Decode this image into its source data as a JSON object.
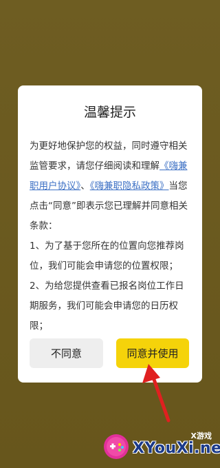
{
  "dialog": {
    "title": "温馨提示",
    "intro_text": "为更好地保护您的权益，同时遵守相关监管要求，请您仔细阅读和理解",
    "link_user_agreement": "《嗨兼职用户协议》",
    "separator": "、",
    "link_privacy_policy": "《嗨兼职隐私政策》",
    "consent_text": "当您点击“同意”即表示您已理解并同意相关条款：",
    "clause_1": "1、为了基于您所在的位置向您推荐岗位，我们可能会申请您的位置权限；",
    "clause_2": "2、为给您提供查看已报名岗位工作日期服务，我们可能会申请您的日历权限；",
    "disagree_label": "不同意",
    "agree_label": "同意并使用"
  },
  "annotation": {
    "arrow_icon": "red-arrow-pointing-up",
    "color": "#e02020"
  },
  "watermark": {
    "site": "XYouXi.net",
    "brand_cn": "X游戏",
    "logo_icon": "gamepad-icon"
  },
  "colors": {
    "backdrop": "#6b5a1f",
    "dialog_bg": "#ffffff",
    "link": "#3b6fc4",
    "agree_button": "#f5d30a",
    "disagree_button": "#eeeeee"
  }
}
